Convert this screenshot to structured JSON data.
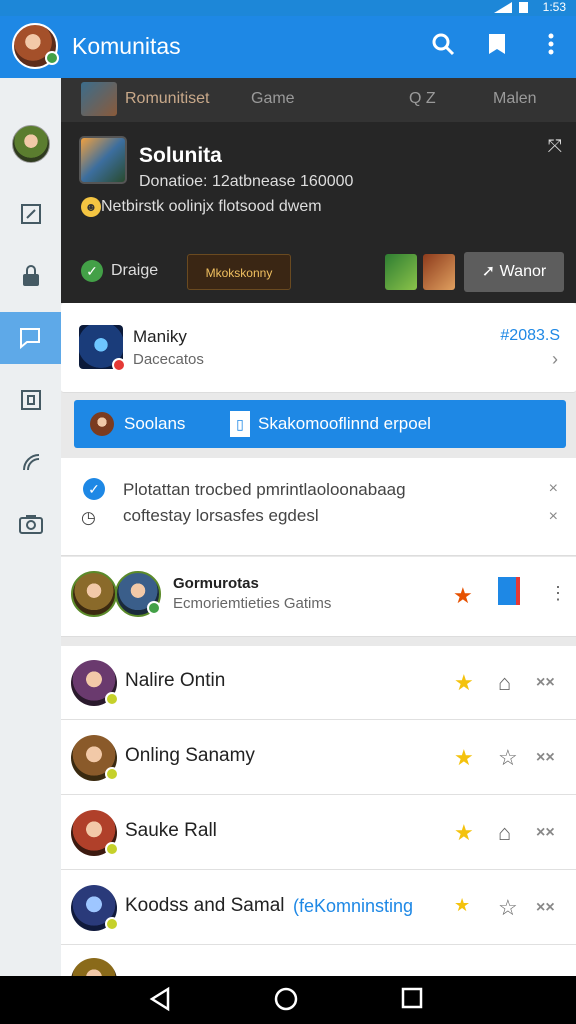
{
  "status_bar": {
    "time": "1:53"
  },
  "appbar": {
    "title": "Komunitas",
    "icons": [
      "search-icon",
      "bookmark-icon",
      "more-vert-icon"
    ]
  },
  "sidebar": {
    "icons": [
      "avatar",
      "edit-icon",
      "lock-icon",
      "chat-icon",
      "square-icon",
      "phone-icon",
      "camera-icon"
    ]
  },
  "subtabs": {
    "tab1": "Romunitiset",
    "tab2": "Game",
    "tab3": "Q  Z",
    "tab4": "Malen"
  },
  "hero": {
    "title": "Solunita",
    "subtitle": "Donatioe: 12atbnease 160000",
    "description": "Netbirstk oolinjx flotsood dwem",
    "status": "Draige",
    "badge": "Mkokskonny",
    "button": "Wanor"
  },
  "featured": {
    "name": "Maniky",
    "sub": "Dacecatos",
    "value": "#2083.S"
  },
  "blue_bar": {
    "left": "Soolans",
    "right": "Skakomooflinnd erpoel"
  },
  "notice": {
    "line1": "Plotattan trocbed pmrintlaoloonabaag",
    "line2": "coftestay lorsasfes egdesl"
  },
  "group": {
    "title": "Gormurotas",
    "sub": "Ecmoriemtieties Gatims"
  },
  "members": [
    {
      "name": "Nalire Ontin",
      "extra": ""
    },
    {
      "name": "Onling Sanamy",
      "extra": ""
    },
    {
      "name": "Sauke Rall",
      "extra": ""
    },
    {
      "name": "Koodss and Samal",
      "extra": "(feKomninsting"
    }
  ],
  "row_actions": {
    "star": "★",
    "outline": "☆",
    "close": "××"
  },
  "colors": {
    "primary": "#1e88e5",
    "dark": "#262626",
    "star": "#f4c20d"
  }
}
